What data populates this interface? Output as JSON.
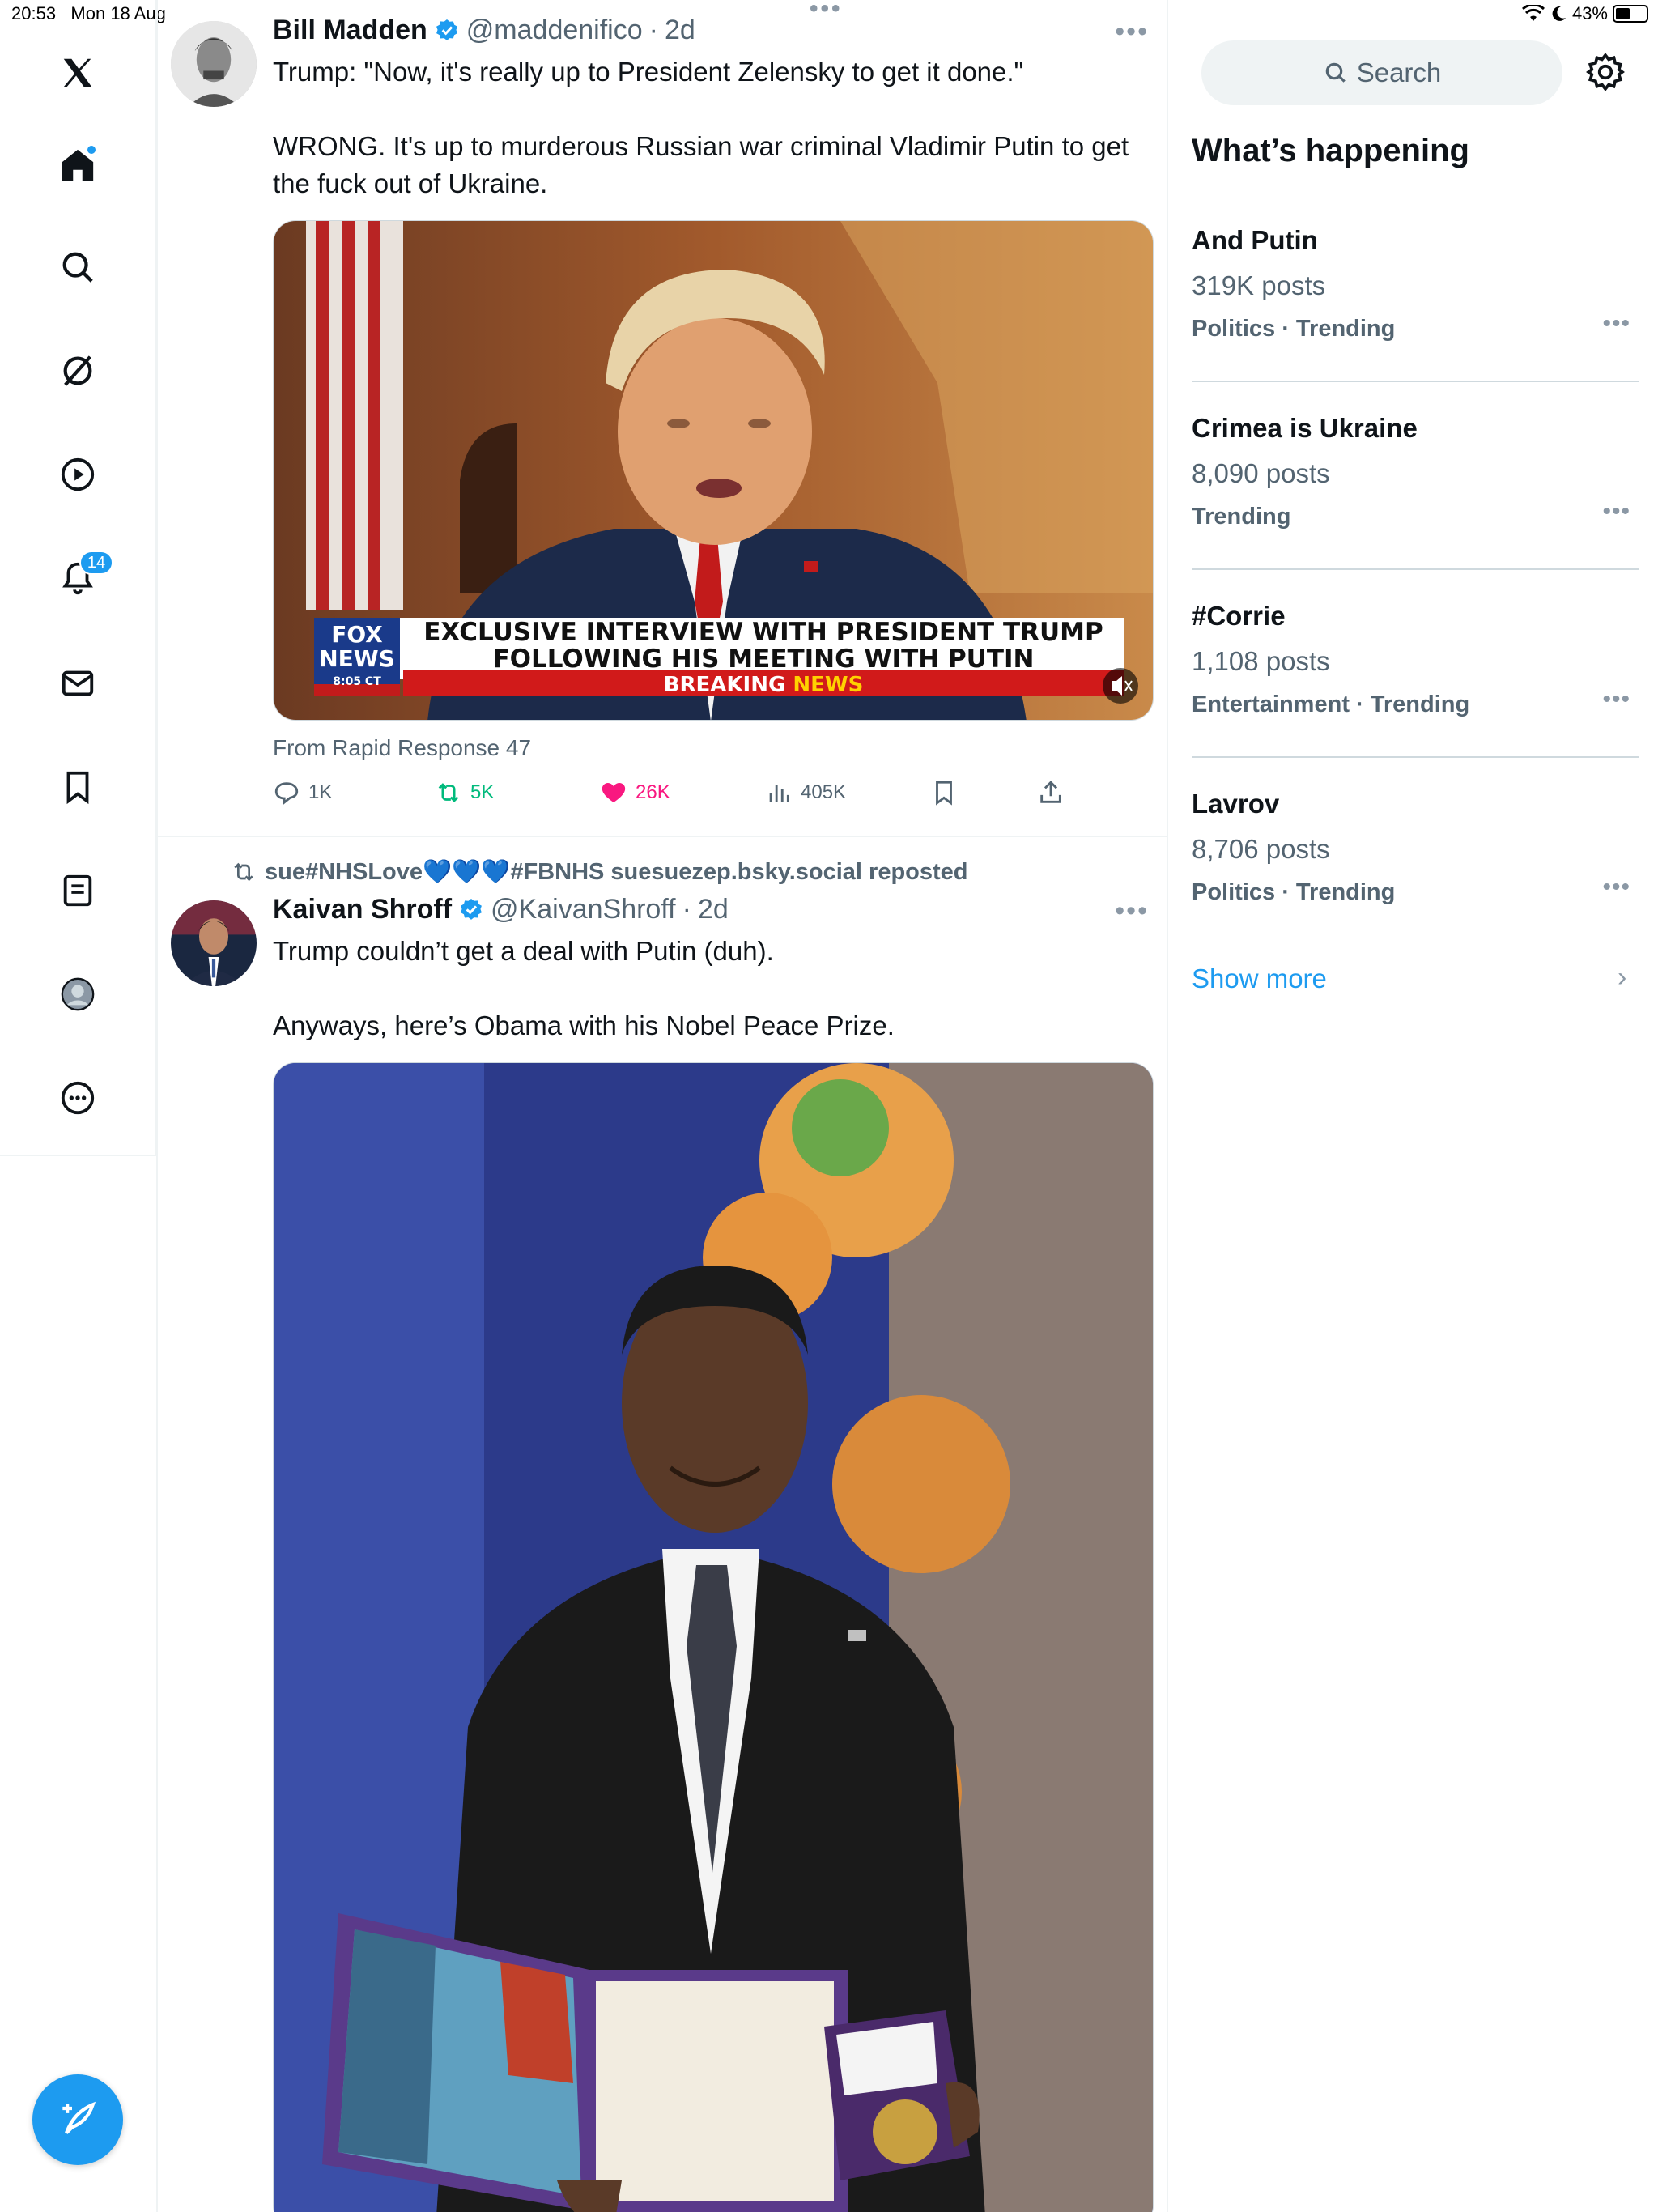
{
  "status_bar": {
    "time": "20:53",
    "date": "Mon 18 Aug",
    "battery": "43%",
    "battery_level": 0.43
  },
  "nav": {
    "items": [
      "x-logo-icon",
      "home-icon",
      "search-icon",
      "grok-icon",
      "video-icon",
      "bell-icon",
      "mail-icon",
      "bookmark-icon",
      "lists-icon",
      "profile-icon",
      "more-icon"
    ],
    "notifications_badge": "14"
  },
  "feed": {
    "tweets": [
      {
        "author": "Bill Madden",
        "handle": "@maddenifico",
        "time": "2d",
        "text": "Trump: \"Now, it's really up to President Zelensky to get it done.\"\n\nWRONG. It's up to murderous Russian war criminal Vladimir Putin to get the fuck out of Ukraine.",
        "media_banner_line1": "EXCLUSIVE INTERVIEW WITH PRESIDENT TRUMP",
        "media_banner_line2": "FOLLOWING HIS MEETING WITH PUTIN",
        "media_banner_breaking": "BREAKING",
        "media_banner_news": "NEWS",
        "media_logo_line1": "FOX",
        "media_logo_line2": "NEWS",
        "media_logo_time": "8:05 CT",
        "source": "From Rapid Response 47",
        "replies": "1K",
        "reposts": "5K",
        "likes": "26K",
        "views": "405K"
      },
      {
        "repost_by": "sue#NHSLove💙💙💙#FBNHS suesuezep.bsky.social reposted",
        "author": "Kaivan Shroff",
        "handle": "@KaivanShroff",
        "time": "2d",
        "text": "Trump couldn’t get a deal with Putin (duh).\n\nAnyways, here’s Obama with his Nobel Peace Prize."
      }
    ]
  },
  "sidebar": {
    "search_placeholder": "Search",
    "title": "What’s happening",
    "trends": [
      {
        "name": "And Putin",
        "posts": "319K posts",
        "category": "Politics · Trending"
      },
      {
        "name": "Crimea is Ukraine",
        "posts": "8,090 posts",
        "category": "Trending"
      },
      {
        "name": "#Corrie",
        "posts": "1,108 posts",
        "category": "Entertainment · Trending"
      },
      {
        "name": "Lavrov",
        "posts": "8,706 posts",
        "category": "Politics · Trending"
      }
    ],
    "show_more": "Show more"
  },
  "colors": {
    "accent": "#1d9bf0",
    "like": "#f91880",
    "repost": "#00ba7c",
    "text": "#0f1419",
    "muted": "#536471"
  }
}
